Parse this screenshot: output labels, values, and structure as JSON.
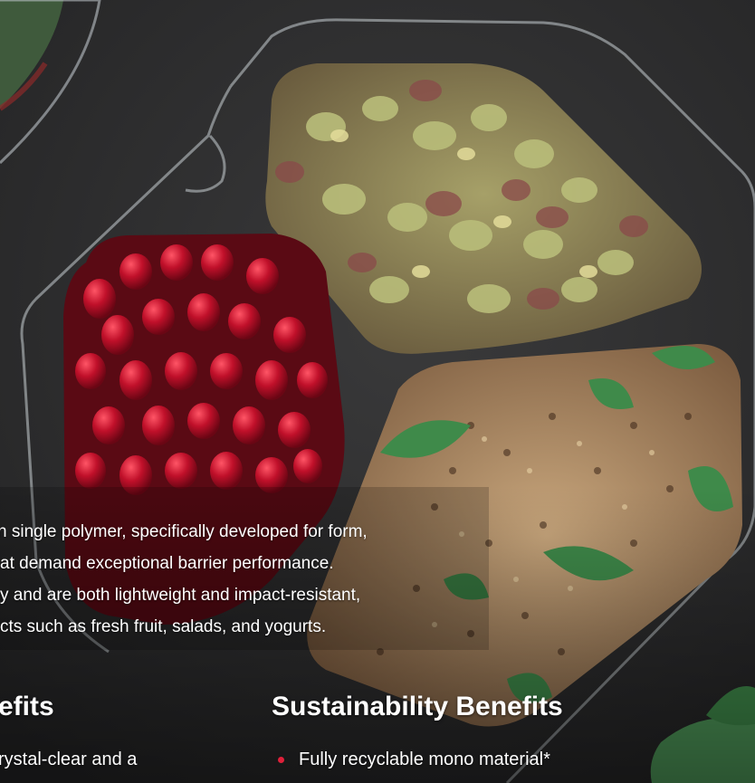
{
  "colors": {
    "background": "#2d2d2e",
    "accent_bullet": "#e0203a",
    "text": "#ffffff"
  },
  "paragraph": {
    "lines": [
      "n single polymer, specifically developed for form,",
      "at demand exceptional barrier performance.",
      "y and are both lightweight and impact-resistant,",
      "cts such as fresh fruit, salads, and yogurts."
    ]
  },
  "left_column": {
    "heading": "efits",
    "first_bullet": "rystal-clear and a"
  },
  "right_column": {
    "heading": "Sustainability Benefits",
    "first_bullet": "Fully recyclable mono material*"
  }
}
